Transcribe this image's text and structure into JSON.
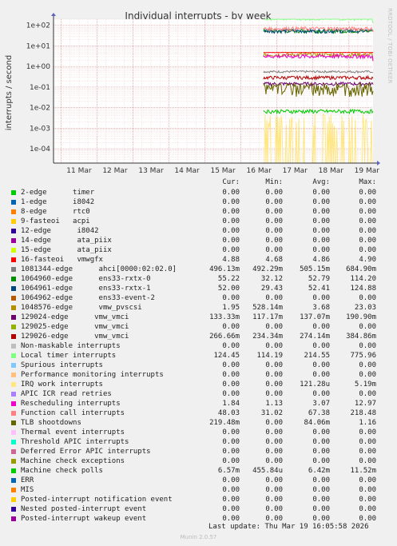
{
  "title": "Individual interrupts - by week",
  "vertical_credit": "RRDTOOL / TOBI OETIKER",
  "footer": {
    "last_update": "Last update: Thu Mar 19 16:05:58 2026",
    "version": "Munin 2.0.57"
  },
  "columns": {
    "cur": "Cur:",
    "min": "Min:",
    "avg": "Avg:",
    "max": "Max:"
  },
  "chart_data": {
    "type": "line",
    "title": "Individual interrupts - by week",
    "ylabel": "interrupts / second",
    "yscale": "log",
    "ylim": [
      2e-05,
      200
    ],
    "y_ticks": [
      "1e-04",
      "1e-03",
      "1e-02",
      "1e-01",
      "1e+00",
      "1e+01",
      "1e+02"
    ],
    "x_ticks": [
      "11 Mar",
      "12 Mar",
      "13 Mar",
      "14 Mar",
      "15 Mar",
      "16 Mar",
      "17 Mar",
      "18 Mar",
      "19 Mar"
    ],
    "x_range": [
      "2026-03-10T19:00",
      "2026-03-19T16:05"
    ],
    "data_start": "2026-03-16T15:00",
    "grid": true,
    "series": [
      {
        "name": "2-edge      timer",
        "color": "#00cc00",
        "cur": "0.00",
        "min": "0.00",
        "avg": "0.00",
        "max": "0.00"
      },
      {
        "name": "1-edge      i8042",
        "color": "#0066b3",
        "cur": "0.00",
        "min": "0.00",
        "avg": "0.00",
        "max": "0.00"
      },
      {
        "name": "8-edge      rtc0",
        "color": "#ff8000",
        "cur": "0.00",
        "min": "0.00",
        "avg": "0.00",
        "max": "0.00"
      },
      {
        "name": "9-fasteoi   acpi",
        "color": "#ffcc00",
        "cur": "0.00",
        "min": "0.00",
        "avg": "0.00",
        "max": "0.00"
      },
      {
        "name": "12-edge      i8042",
        "color": "#330099",
        "cur": "0.00",
        "min": "0.00",
        "avg": "0.00",
        "max": "0.00"
      },
      {
        "name": "14-edge      ata_piix",
        "color": "#990099",
        "cur": "0.00",
        "min": "0.00",
        "avg": "0.00",
        "max": "0.00"
      },
      {
        "name": "15-edge      ata_piix",
        "color": "#ccff00",
        "cur": "0.00",
        "min": "0.00",
        "avg": "0.00",
        "max": "0.00"
      },
      {
        "name": "16-fasteoi   vmwgfx",
        "color": "#ff0000",
        "cur": "4.88",
        "min": "4.68",
        "avg": "4.86",
        "max": "4.90"
      },
      {
        "name": "1081344-edge      ahci[0000:02:02.0]",
        "color": "#808080",
        "cur": "496.13m",
        "min": "492.29m",
        "avg": "505.15m",
        "max": "684.90m"
      },
      {
        "name": "1064960-edge      ens33-rxtx-0",
        "color": "#008f00",
        "cur": "55.22",
        "min": "32.12",
        "avg": "52.79",
        "max": "114.20"
      },
      {
        "name": "1064961-edge      ens33-rxtx-1",
        "color": "#00487d",
        "cur": "52.00",
        "min": "29.43",
        "avg": "52.41",
        "max": "124.88"
      },
      {
        "name": "1064962-edge      ens33-event-2",
        "color": "#b35a00",
        "cur": "0.00",
        "min": "0.00",
        "avg": "0.00",
        "max": "0.00"
      },
      {
        "name": "1048576-edge      vmw_pvscsi",
        "color": "#b38f00",
        "cur": "1.95",
        "min": "528.14m",
        "avg": "3.68",
        "max": "23.03"
      },
      {
        "name": "129024-edge      vmw_vmci",
        "color": "#6b006b",
        "cur": "133.33m",
        "min": "117.17m",
        "avg": "137.07m",
        "max": "190.90m"
      },
      {
        "name": "129025-edge      vmw_vmci",
        "color": "#8fb300",
        "cur": "0.00",
        "min": "0.00",
        "avg": "0.00",
        "max": "0.00"
      },
      {
        "name": "129026-edge      vmw_vmci",
        "color": "#b30000",
        "cur": "266.66m",
        "min": "234.34m",
        "avg": "274.14m",
        "max": "384.86m"
      },
      {
        "name": "Non-maskable interrupts",
        "color": "#bebebe",
        "cur": "0.00",
        "min": "0.00",
        "avg": "0.00",
        "max": "0.00"
      },
      {
        "name": "Local timer interrupts",
        "color": "#80ff80",
        "cur": "124.45",
        "min": "114.19",
        "avg": "214.55",
        "max": "775.96"
      },
      {
        "name": "Spurious interrupts",
        "color": "#80c9ff",
        "cur": "0.00",
        "min": "0.00",
        "avg": "0.00",
        "max": "0.00"
      },
      {
        "name": "Performance monitoring interrupts",
        "color": "#ffc080",
        "cur": "0.00",
        "min": "0.00",
        "avg": "0.00",
        "max": "0.00"
      },
      {
        "name": "IRQ work interrupts",
        "color": "#ffe680",
        "cur": "0.00",
        "min": "0.00",
        "avg": "121.28u",
        "max": "5.19m"
      },
      {
        "name": "APIC ICR read retries",
        "color": "#aa80ff",
        "cur": "0.00",
        "min": "0.00",
        "avg": "0.00",
        "max": "0.00"
      },
      {
        "name": "Rescheduling interrupts",
        "color": "#ee00cc",
        "cur": "1.84",
        "min": "1.13",
        "avg": "3.07",
        "max": "12.97"
      },
      {
        "name": "Function call interrupts",
        "color": "#ff8080",
        "cur": "48.03",
        "min": "31.02",
        "avg": "67.38",
        "max": "218.48"
      },
      {
        "name": "TLB shootdowns",
        "color": "#666600",
        "cur": "219.48m",
        "min": "0.00",
        "avg": "84.06m",
        "max": "1.16"
      },
      {
        "name": "Thermal event interrupts",
        "color": "#ffbfff",
        "cur": "0.00",
        "min": "0.00",
        "avg": "0.00",
        "max": "0.00"
      },
      {
        "name": "Threshold APIC interrupts",
        "color": "#00ffcc",
        "cur": "0.00",
        "min": "0.00",
        "avg": "0.00",
        "max": "0.00"
      },
      {
        "name": "Deferred Error APIC interrupts",
        "color": "#cc6699",
        "cur": "0.00",
        "min": "0.00",
        "avg": "0.00",
        "max": "0.00"
      },
      {
        "name": "Machine check exceptions",
        "color": "#999900",
        "cur": "0.00",
        "min": "0.00",
        "avg": "0.00",
        "max": "0.00"
      },
      {
        "name": "Machine check polls",
        "color": "#00cc00",
        "cur": "6.57m",
        "min": "455.84u",
        "avg": "6.42m",
        "max": "11.52m"
      },
      {
        "name": "ERR",
        "color": "#0066b3",
        "cur": "0.00",
        "min": "0.00",
        "avg": "0.00",
        "max": "0.00"
      },
      {
        "name": "MIS",
        "color": "#ff8000",
        "cur": "0.00",
        "min": "0.00",
        "avg": "0.00",
        "max": "0.00"
      },
      {
        "name": "Posted-interrupt notification event",
        "color": "#ffcc00",
        "cur": "0.00",
        "min": "0.00",
        "avg": "0.00",
        "max": "0.00"
      },
      {
        "name": "Nested posted-interrupt event",
        "color": "#330099",
        "cur": "0.00",
        "min": "0.00",
        "avg": "0.00",
        "max": "0.00"
      },
      {
        "name": "Posted-interrupt wakeup event",
        "color": "#990099",
        "cur": "0.00",
        "min": "0.00",
        "avg": "0.00",
        "max": "0.00"
      }
    ]
  }
}
